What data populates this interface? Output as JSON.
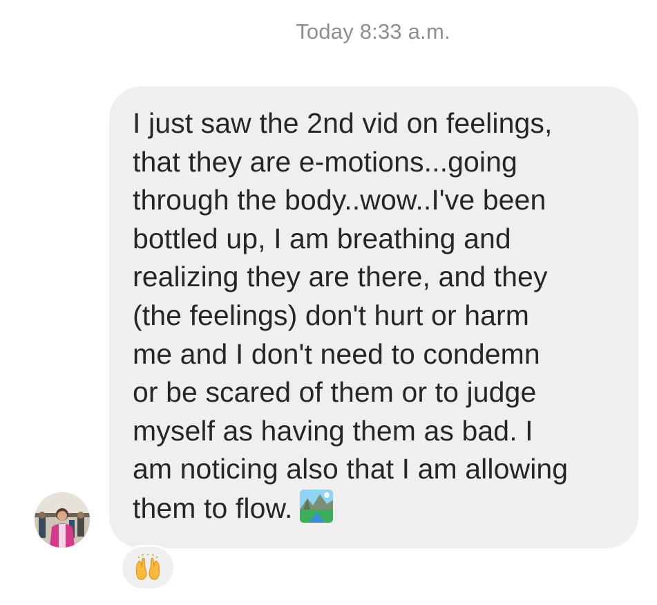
{
  "thread": {
    "timestamp": "Today 8:33 a.m."
  },
  "message": {
    "sender_avatar": "avatar-photo",
    "text": "I just saw the 2nd vid on feelings,\nthat they are e-motions...going\nthrough the body..wow..I've been\nbottled up, I am breathing and\nrealizing they are there, and they\n(the feelings) don't hurt or harm\nme and I don't need to condemn\nor be scared of them or to judge\nmyself as having them as bad. I\nam noticing also that I am allowing\nthem to flow.",
    "inline_emoji": "national-park-emoji",
    "reaction": "raising-hands-emoji"
  },
  "colors": {
    "bubble": "#efefef",
    "text": "#262626",
    "timestamp": "#8e8e8e"
  }
}
